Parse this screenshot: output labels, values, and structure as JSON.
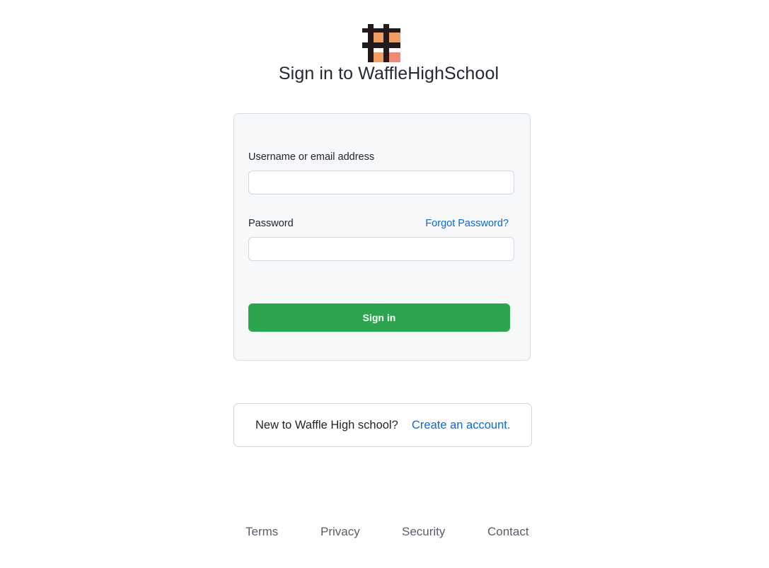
{
  "header": {
    "logo_icon": "waffle-logo-icon",
    "title": "Sign in to WaffleHighSchool"
  },
  "login_form": {
    "username_label": "Username or email address",
    "username_value": "",
    "username_placeholder": "",
    "password_label": "Password",
    "password_value": "",
    "password_placeholder": "",
    "forgot_password_link": "Forgot Password?",
    "sign_in_button": "Sign in"
  },
  "signup_prompt": {
    "text": "New to Waffle High school?",
    "link": "Create an account."
  },
  "footer": {
    "links": [
      "Terms",
      "Privacy",
      "Security",
      "Contact"
    ]
  },
  "colors": {
    "primary_button": "#2da44e",
    "link": "#0969da",
    "card_background": "#f6f8fa",
    "logo_dark": "#24191b",
    "logo_orange": "#f19e63",
    "logo_pink": "#f08a78"
  }
}
